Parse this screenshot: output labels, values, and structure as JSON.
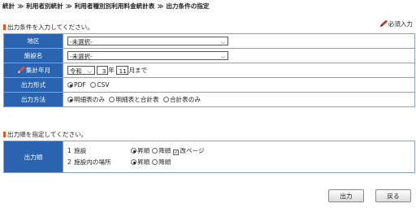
{
  "breadcrumb": [
    "統計",
    "利用者別統計",
    "利用者種別別利用料金統計表",
    "出力条件の指定"
  ],
  "breadcrumb_separator": "≫",
  "section1_title": "出力条件を入力してください。",
  "required_note": "必須入力",
  "fields": {
    "region": {
      "label": "地区",
      "value": "-未選択-"
    },
    "facility": {
      "label": "施設名",
      "value": "-未選択-"
    },
    "period": {
      "label": "集計年月",
      "era": "令和",
      "year": "3",
      "year_unit": "年",
      "month": "11",
      "month_suffix": "月まで"
    },
    "format": {
      "label": "出力形式",
      "options": [
        "PDF",
        "CSV"
      ],
      "selected": 0
    },
    "method": {
      "label": "出力方法",
      "options": [
        "明細表のみ",
        "明細表と合計表",
        "合計表のみ"
      ],
      "selected": 0
    }
  },
  "section2_title": "出力順を指定してください。",
  "order": {
    "label": "出力順",
    "rows": [
      {
        "num": "1",
        "name": "施設",
        "asc": "昇順",
        "desc": "降順",
        "pagebreak": "改ページ"
      },
      {
        "num": "2",
        "name": "施設内の場所",
        "asc": "昇順",
        "desc": "降順"
      }
    ]
  },
  "buttons": {
    "output": "出力",
    "back": "戻る"
  },
  "colors": {
    "header_bg": "#2a64b0",
    "border": "#8aa0c8",
    "accent_mark": "#e05a1a"
  }
}
